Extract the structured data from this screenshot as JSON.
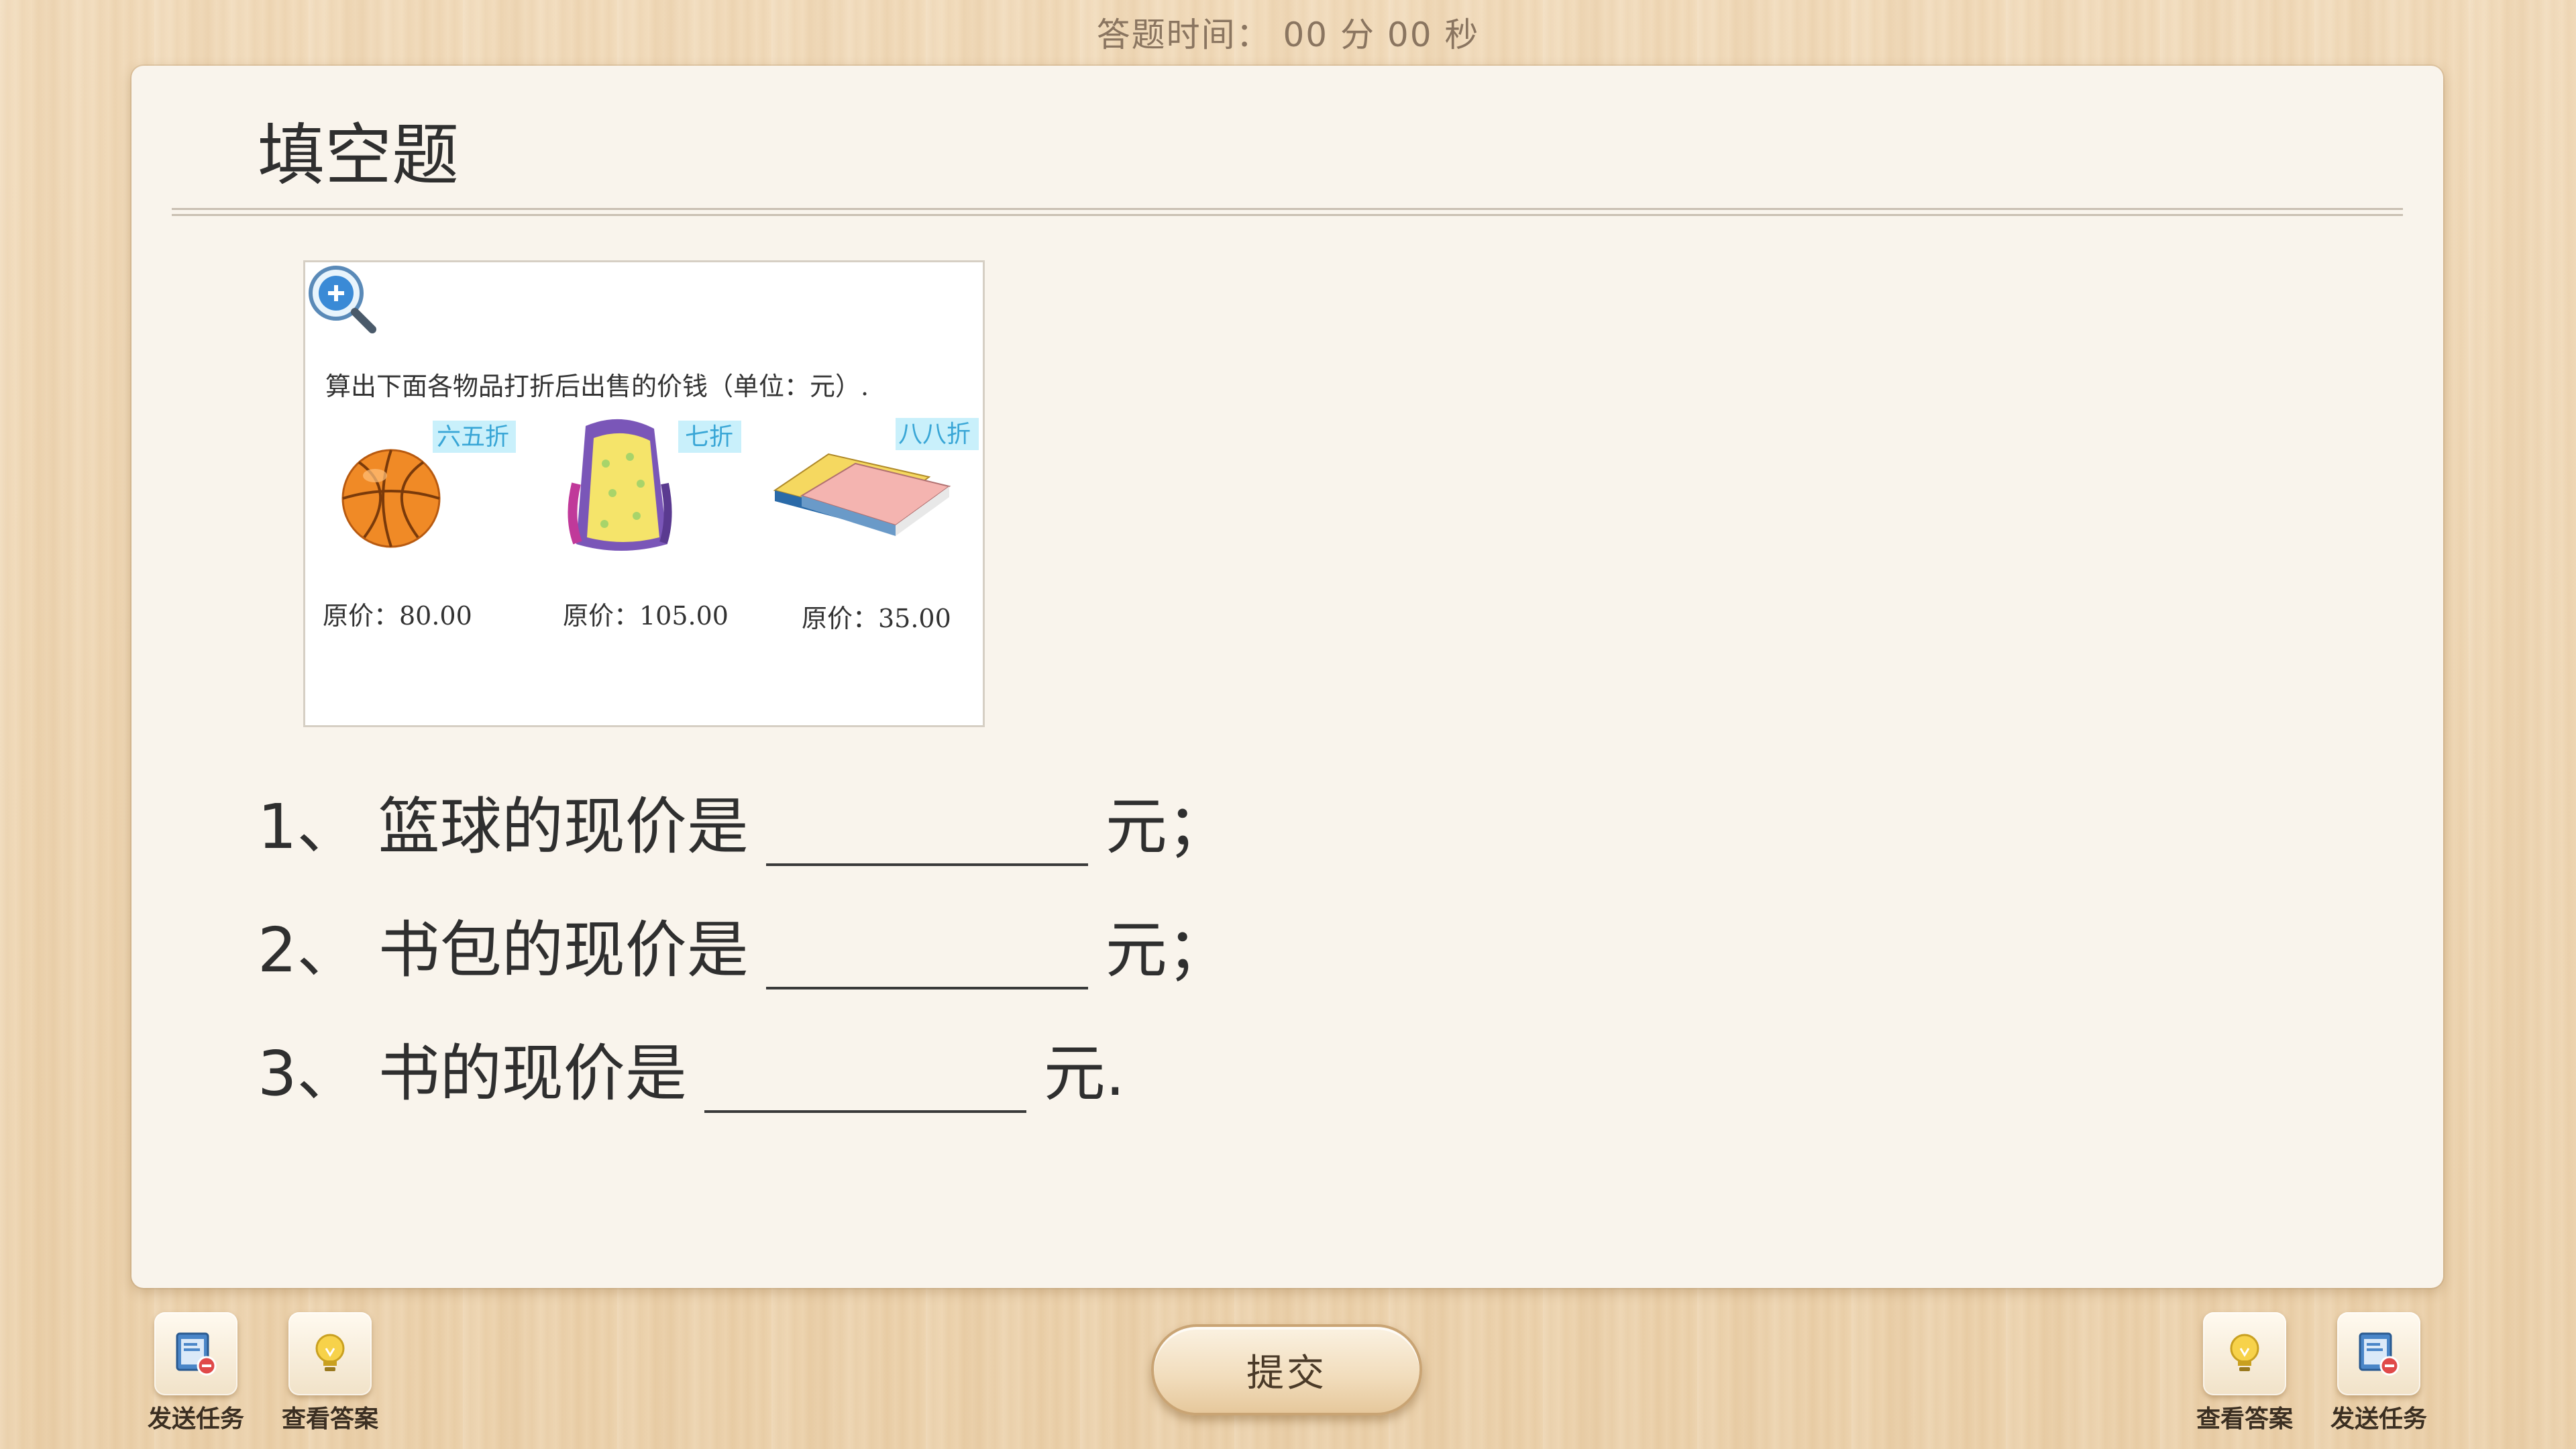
{
  "timer": {
    "text": "答题时间： 00 分 00 秒"
  },
  "panel": {
    "title": "填空题"
  },
  "figure": {
    "instruction": "算出下面各物品打折后出售的价钱（单位：元）.",
    "items": [
      {
        "name": "basketball",
        "discount": "六五折",
        "price_label": "原价：80.00"
      },
      {
        "name": "backpack",
        "discount": "七折",
        "price_label": "原价：105.00"
      },
      {
        "name": "books",
        "discount": "八八折",
        "price_label": "原价：35.00"
      }
    ],
    "zoom_icon": "zoom-in-icon"
  },
  "questions": [
    {
      "prefix": "1、 篮球的现价是",
      "suffix": "元；",
      "value": ""
    },
    {
      "prefix": "2、 书包的现价是",
      "suffix": "元；",
      "value": ""
    },
    {
      "prefix": "3、 书的现价是",
      "suffix": "元.",
      "value": ""
    }
  ],
  "toolbar": {
    "left": [
      {
        "label": "发送任务",
        "icon": "send-task-icon"
      },
      {
        "label": "查看答案",
        "icon": "lightbulb-icon"
      }
    ],
    "right": [
      {
        "label": "查看答案",
        "icon": "lightbulb-icon"
      },
      {
        "label": "发送任务",
        "icon": "send-task-icon"
      }
    ],
    "submit_label": "提交"
  },
  "colors": {
    "panel_bg": "#f9f4ec",
    "discount_tag_bg": "#c9f0fb",
    "discount_tag_text": "#39a6d6"
  }
}
